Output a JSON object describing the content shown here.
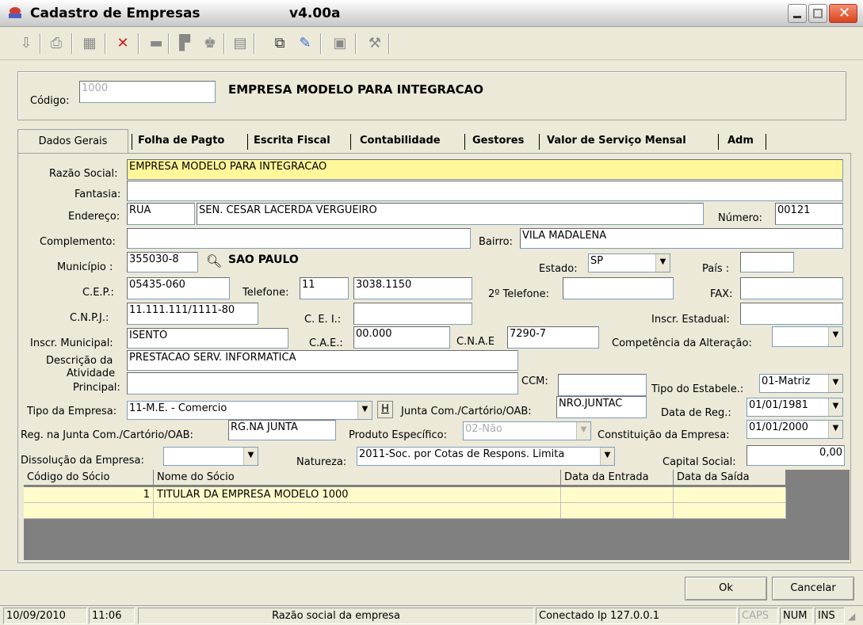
{
  "window": {
    "title": "Cadastro de Empresas",
    "version": "v4.00a"
  },
  "toolbar": {
    "icons": [
      "exit-icon",
      "print-icon",
      "new-icon",
      "delete-icon",
      "save-icon",
      "report-icon",
      "search-icon",
      "edit-icon",
      "copy-icon",
      "export-icon",
      "settings-icon",
      "tools-icon"
    ]
  },
  "header": {
    "codigo_label": "Código:",
    "codigo_value": "1000",
    "empresa_nome": "EMPRESA MODELO PARA INTEGRACAO"
  },
  "tabs": [
    "Dados Gerais",
    "Folha de Pagto",
    "Escrita Fiscal",
    "Contabilidade",
    "Gestores",
    "Valor de Serviço Mensal",
    "Adm"
  ],
  "form": {
    "razao_label": "Razão Social:",
    "razao_value": "EMPRESA MODELO PARA INTEGRACAO",
    "fantasia_label": "Fantasia:",
    "fantasia_value": "",
    "endereco_label": "Endereço:",
    "endereco_tipo": "RUA",
    "endereco_value": "SEN. CESAR LACERDA VERGUEIRO",
    "numero_label": "Número:",
    "numero_value": "00121",
    "complemento_label": "Complemento:",
    "complemento_value": "",
    "bairro_label": "Bairro:",
    "bairro_value": "VILA MADALENA",
    "municipio_label": "Município :",
    "municipio_value": "355030-8",
    "municipio_nome": "SAO PAULO",
    "estado_label": "Estado:",
    "estado_value": "SP",
    "pais_label": "País :",
    "pais_value": "",
    "cep_label": "C.E.P.:",
    "cep_value": "05435-060",
    "telefone_label": "Telefone:",
    "telefone_ddd": "11",
    "telefone_value": "3038.1150",
    "telefone2_label": "2º Telefone:",
    "telefone2_value": "",
    "fax_label": "FAX:",
    "fax_value": "",
    "cnpj_label": "C.N.P.J.:",
    "cnpj_value": "11.111.111/1111-80",
    "cei_label": "C. E. I.:",
    "cei_value": "",
    "inscr_estadual_label": "Inscr. Estadual:",
    "inscr_estadual_value": "",
    "inscr_municipal_label": "Inscr. Municipal:",
    "inscr_municipal_value": "ISENTO",
    "cae_label": "C.A.E.:",
    "cae_value": "00.000",
    "cnae_label": "C.N.A.E",
    "cnae_value": "7290-7",
    "competencia_label": "Competência da Alteração:",
    "competencia_value": "",
    "descricao_label": "Descrição da",
    "descricao_value": "PRESTACAO SERV. INFORMATICA",
    "atividade_label1": "Atividade",
    "atividade_label2": "Principal:",
    "atividade_value": "",
    "ccm_label": "CCM:",
    "ccm_value": "",
    "tipo_estab_label": "Tipo do Estabele.:",
    "tipo_estab_value": "01-Matriz",
    "tipo_empresa_label": "Tipo da Empresa:",
    "tipo_empresa_value": "11-M.E. - Comercio",
    "h_button": "H",
    "junta_label": "Junta Com./Cartório/OAB:",
    "junta_value": "NRO.JUNTAC",
    "data_reg_label": "Data de Reg.:",
    "data_reg_value": "01/01/1981",
    "reg_junta_label": "Reg. na Junta Com./Cartório/OAB:",
    "reg_junta_value": "RG.NA JUNTA",
    "produto_label": "Produto Específico:",
    "produto_value": "02-Não",
    "constituicao_label": "Constituição da Empresa:",
    "constituicao_value": "01/01/2000",
    "dissolucao_label": "Dissolução da Empresa:",
    "dissolucao_value": "",
    "natureza_label": "Natureza:",
    "natureza_value": "2011-Soc. por Cotas de Respons. Limita",
    "capital_label": "Capital Social:",
    "capital_value": "0,00"
  },
  "grid": {
    "headers": [
      "Código do Sócio",
      "Nome do Sócio",
      "Data da Entrada",
      "Data da Saída"
    ],
    "rows": [
      [
        "1",
        "TITULAR DA EMPRESA MODELO 1000",
        "",
        ""
      ]
    ]
  },
  "buttons": {
    "ok": "Ok",
    "cancelar": "Cancelar"
  },
  "status": {
    "date": "10/09/2010",
    "time": "11:06",
    "message": "Razão social da empresa",
    "connection": "Conectado Ip 127.0.0.1",
    "caps": "CAPS",
    "num": "NUM",
    "ins": "INS"
  }
}
